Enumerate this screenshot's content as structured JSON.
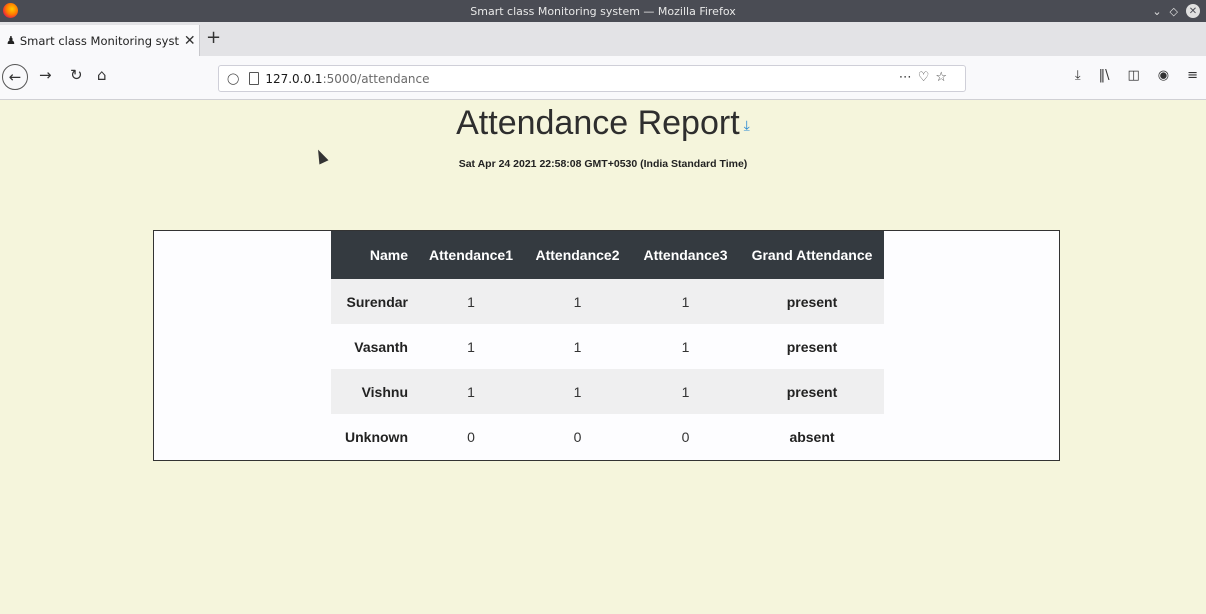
{
  "window": {
    "title": "Smart class Monitoring system — Mozilla Firefox"
  },
  "tabs": [
    {
      "label": "Smart class Monitoring syst",
      "icon": "person-icon"
    }
  ],
  "toolbar": {
    "url_host": "127.0.0.1",
    "url_path": ":5000/attendance"
  },
  "page": {
    "title": "Attendance Report",
    "datetime": "Sat Apr 24 2021 22:58:08 GMT+0530 (India Standard Time)"
  },
  "table": {
    "headers": [
      "Name",
      "Attendance1",
      "Attendance2",
      "Attendance3",
      "Grand Attendance"
    ],
    "rows": [
      [
        "Surendar",
        "1",
        "1",
        "1",
        "present"
      ],
      [
        "Vasanth",
        "1",
        "1",
        "1",
        "present"
      ],
      [
        "Vishnu",
        "1",
        "1",
        "1",
        "present"
      ],
      [
        "Unknown",
        "0",
        "0",
        "0",
        "absent"
      ]
    ]
  },
  "colors": {
    "page_bg": "#f5f5dc",
    "header_bg": "#343a40",
    "accent": "#2a8ad4"
  }
}
